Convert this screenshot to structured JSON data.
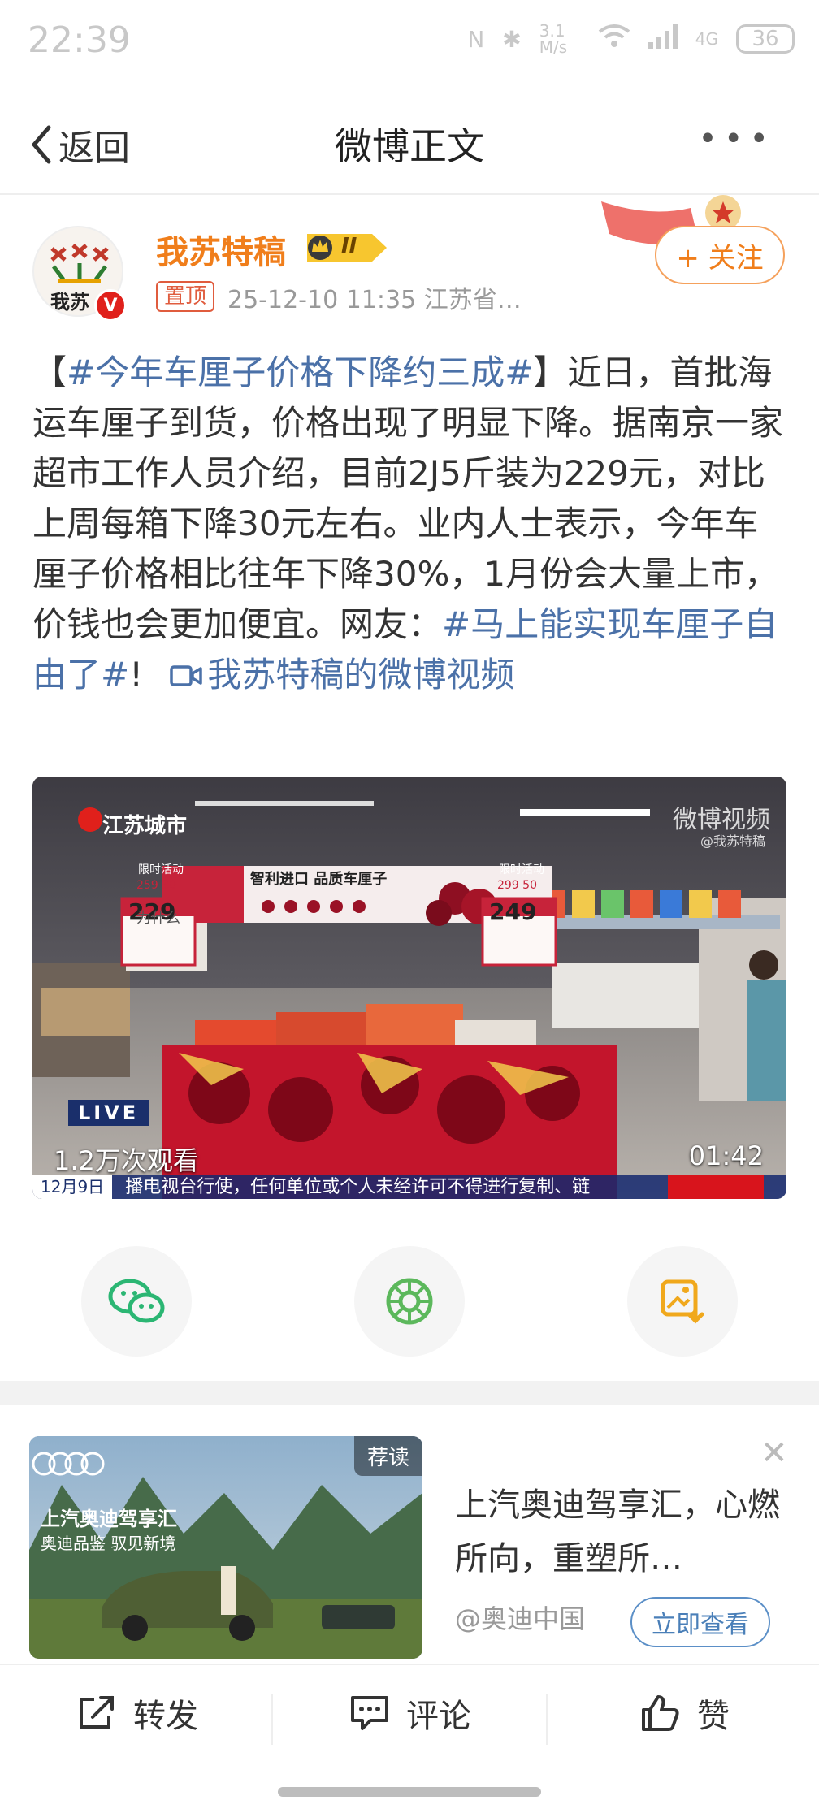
{
  "status_bar": {
    "time": "22:39",
    "network_speed": "3.1 M/s",
    "signal": "4G",
    "battery": "36"
  },
  "nav": {
    "back_label": "返回",
    "title": "微博正文",
    "more": "•••"
  },
  "author": {
    "name": "我苏特稿",
    "avatar_text": "我苏",
    "pin_label": "置顶",
    "meta": "25-12-10 11:35  江苏省…",
    "follow_label": "+ 关注",
    "vip_level": "II"
  },
  "post": {
    "tag1": "#今年车厘子价格下降约三成#",
    "text_part1": "近日，首批海运车厘子到货，价格出现了明显下降。据南京一家超市工作人员介绍，目前2J5斤装为229元，对比上周每箱下降30元左右。业内人士表示，今年车厘子价格相比往年下降30%，1月份会大量上市，价钱也会更加便宜。网友：",
    "tag2": "#马上能实现车厘子自由了#",
    "after_tag2": "!",
    "video_link": "我苏特稿的微博视频"
  },
  "video": {
    "logo": "江苏城市",
    "watermark": "微博视频",
    "author_mark": "@我苏特稿",
    "live_label": "LIVE",
    "views": "1.2万次观看",
    "duration": "01:42",
    "ticker_date": "12月9日",
    "ticker_text": "播电视台行使，任何单位或个人未经许可不得进行复制、链",
    "sign_left_label": "限时活动",
    "sign_left_price": "229",
    "sign_left_old": "259 30",
    "sign_center": "智利进口 品质车厘子",
    "sign_right_label": "限时活动",
    "sign_right_price": "249",
    "sign_right_old": "299 50",
    "pillar_text": "为什么"
  },
  "share": {
    "wechat": "wechat-share",
    "moments": "moments-share",
    "save": "save-image"
  },
  "ad": {
    "tag": "荐读",
    "brand": "上汽奥迪驾享汇",
    "sub": "奥迪品鉴 驭见新境",
    "title": "上汽奥迪驾享汇，心燃所向，重塑所…",
    "source": "@奥迪中国",
    "button": "立即查看"
  },
  "toolbar": {
    "repost": "转发",
    "comment": "评论",
    "like": "赞"
  },
  "colors": {
    "accent": "#f07e1b",
    "link": "#4b71a8",
    "verify": "#e0201b"
  }
}
